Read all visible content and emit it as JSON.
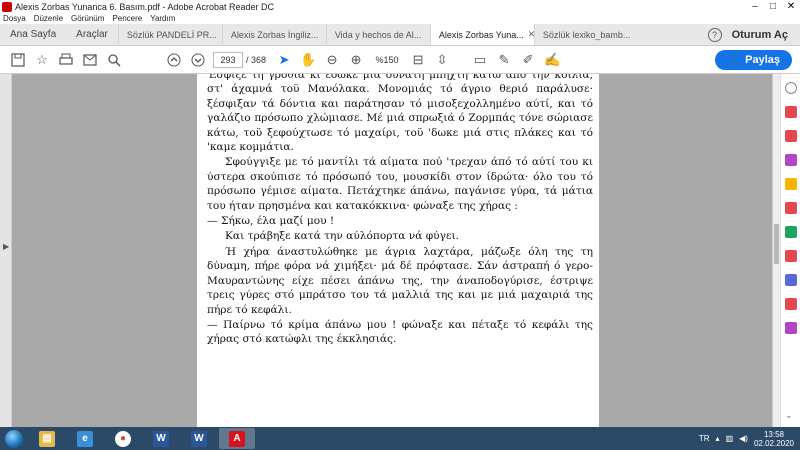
{
  "window": {
    "title": "Alexis Zorbas Yunanca 6. Basım.pdf - Adobe Acrobat Reader DC",
    "minimize": "–",
    "maximize": "□",
    "close": "✕"
  },
  "menu": [
    "Dosya",
    "Düzenle",
    "Görünüm",
    "Pencere",
    "Yardım"
  ],
  "tabs": {
    "home": "Ana Sayfa",
    "tools": "Araçlar",
    "docs": [
      {
        "label": "Sözlük PANDELİ PR...",
        "active": false
      },
      {
        "label": "Alexis Zorbas İngiliz...",
        "active": false
      },
      {
        "label": "Vida y hechos de Al...",
        "active": false
      },
      {
        "label": "Alexis Zorbas Yuna...",
        "active": true
      },
      {
        "label": "Sözlük lexiko_bamb...",
        "active": false
      }
    ],
    "help": "?",
    "login": "Oturum Aç"
  },
  "toolbar": {
    "page_current": "293",
    "page_sep": "/ 368",
    "zoom": "%150",
    "share_label": "Paylaş"
  },
  "document": {
    "paragraphs": [
      "Έσφιξε τη γροθιά κι έδωκε μιά δυνατή μπηχτή κάτω άπό την κοιλιά, στ' άχαμνά τοϋ Μανόλακα. Μονομιάς τό άγριο θεριό παράλυσε· ξέσφιξαν τά δόντια και παράτησαν τό μισοξεχολλημένο αύτί, και τό γαλάζιο πρόσωπο χλώμιασε. Μέ μιά σπρωξιά ό Ζορμπάς τόνε σώριασε κάτω, τοϋ ξεφούχτωσε τό μαχαίρι, τοϋ 'δωκε μιά στις πλάκες και τό 'καμε κομμάτια.",
      "Σφούγγιξε με τό μαντίλι τά αίματα πού 'τρεχαν άπό τό αύτί του κι ύστερα σκούπισε τό πρόσωπό του, μουσκίδι στον ίδρώτα· όλο του τό πρόσωπο γέμισε αίματα. Πετάχτηκε άπάνω, παγάνισε γύρα, τά μάτια του ήταν πρησμένα και κατακόκκινα· φώναξε της χήρας :",
      "— Σήκω, έλα μαζί μου !",
      "Και τράβηξε κατά την αύλόπορτα νά φύγει.",
      "Ή χήρα άναστυλώθηκε με άγρια λαχτάρα, μάζωξε όλη της τη δύναμη, πήρε φόρα νά χιμήξει· μά δέ πρόφτασε. Σάν άστραπή ό γερο-Μαυραντώνης είχε πέσει άπάνω της, την άναποδογύρισε, έστριψε τρεις γύρες στό μπράτσο του τά μαλλιά της και με μιά μαχαιριά της πήρε τό κεφάλι.",
      "— Παίρνω τό κρίμα άπάνω μου ! φώναξε και πέταξε τό κεφάλι της χήρας στό κατώφλι της έκκλησιάς."
    ]
  },
  "taskbar": {
    "apps": [
      {
        "name": "windows-explorer",
        "glyph": "▤",
        "color": "#e8b64a"
      },
      {
        "name": "internet-explorer",
        "glyph": "e",
        "color": "#3b8ed8"
      },
      {
        "name": "chrome",
        "glyph": "●",
        "color": "#db4437"
      },
      {
        "name": "word",
        "glyph": "W",
        "color": "#2b579a"
      },
      {
        "name": "word-2",
        "glyph": "W",
        "color": "#2b579a"
      },
      {
        "name": "acrobat",
        "glyph": "A",
        "color": "#d4141a"
      }
    ],
    "lang": "TR",
    "time": "13:58",
    "date": "02.02.2020"
  }
}
